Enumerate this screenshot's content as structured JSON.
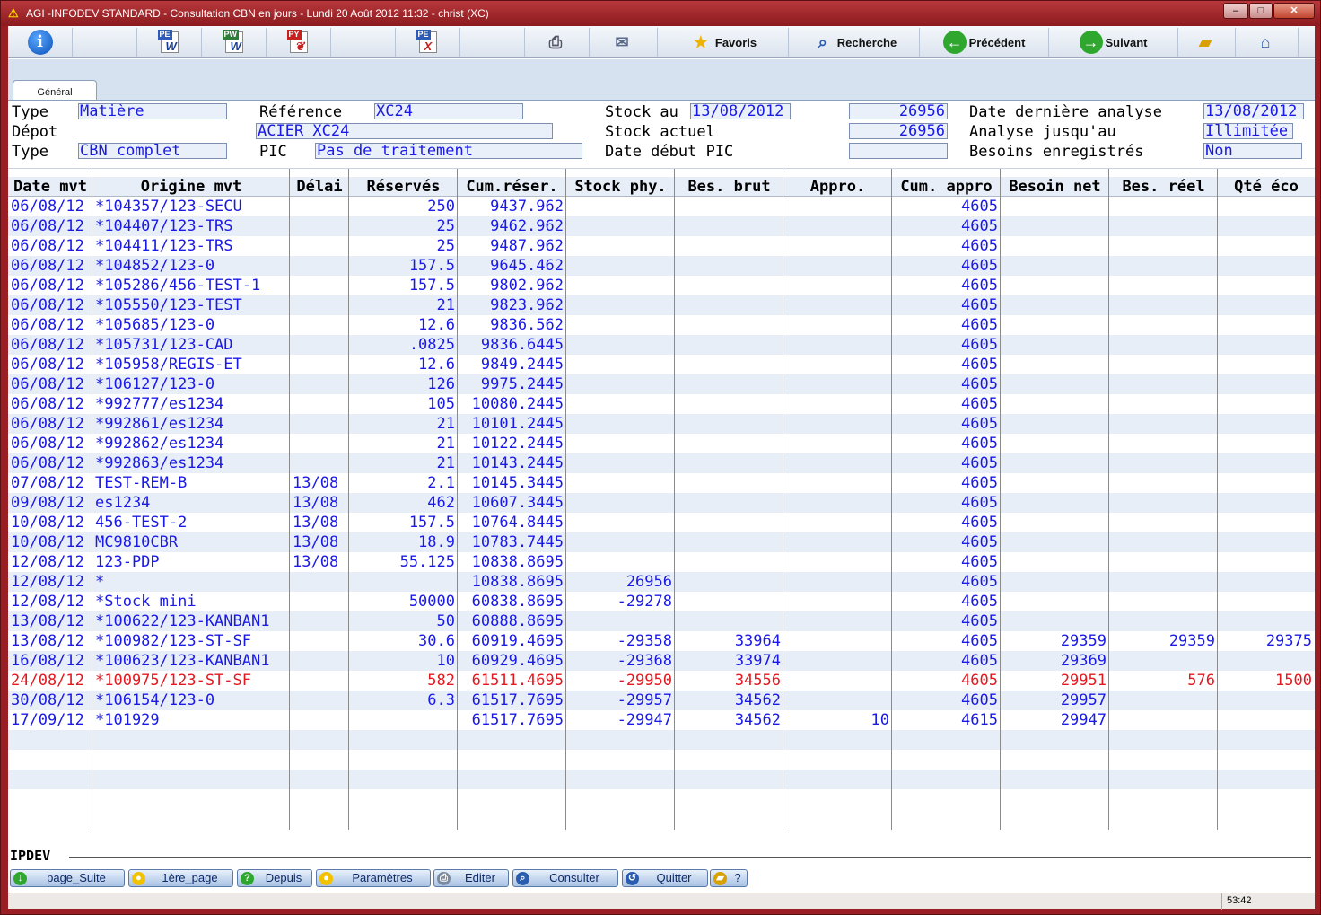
{
  "window": {
    "title": "AGI -INFODEV STANDARD - Consultation CBN en jours - Lundi 20 Août 2012 11:32 - christ (XC)"
  },
  "toolbar": {
    "favoris": "Favoris",
    "recherche": "Recherche",
    "precedent": "Précédent",
    "suivant": "Suivant",
    "doc_pe": "PE",
    "doc_pw": "PW",
    "doc_py": "PY",
    "doc_pe2": "PE"
  },
  "tab": {
    "label": "Général"
  },
  "header": {
    "type_label": "Type",
    "type_value": "Matière",
    "depot_label": "Dépot",
    "type2_label": "Type",
    "type2_value": "CBN complet",
    "reference_label": "Référence",
    "reference_value": "XC24",
    "designation_value": "ACIER XC24",
    "pic_label": "PIC",
    "pic_value": "Pas de traitement",
    "stock_au_label": "Stock au",
    "stock_au_date": "13/08/2012",
    "stock_au_value": "26956",
    "stock_actuel_label": "Stock actuel",
    "stock_actuel_value": "26956",
    "date_debut_pic_label": "Date début PIC",
    "date_debut_pic_value": "",
    "derniere_analyse_label": "Date dernière analyse",
    "derniere_analyse_value": "13/08/2012",
    "analyse_jusqu_label": "Analyse jusqu'au",
    "analyse_jusqu_value": "Illimitée",
    "besoins_label": "Besoins enregistrés",
    "besoins_value": "Non"
  },
  "table": {
    "columns": [
      "Date mvt",
      "Origine mvt",
      "Délai",
      "Réservés",
      "Cum.réser.",
      "Stock phy.",
      "Bes. brut",
      "Appro.",
      "Cum. appro",
      "Besoin net",
      "Bes. réel",
      "Qté éco"
    ],
    "rows": [
      {
        "d": "06/08/12",
        "o": "*104357/123-SECU",
        "del": "",
        "res": "250",
        "cumres": "9437.962",
        "phy": "",
        "brut": "",
        "appro": "",
        "cumappro": "4605",
        "net": "",
        "reel": "",
        "eco": "",
        "red": false
      },
      {
        "d": "06/08/12",
        "o": "*104407/123-TRS",
        "del": "",
        "res": "25",
        "cumres": "9462.962",
        "phy": "",
        "brut": "",
        "appro": "",
        "cumappro": "4605",
        "net": "",
        "reel": "",
        "eco": "",
        "red": false
      },
      {
        "d": "06/08/12",
        "o": "*104411/123-TRS",
        "del": "",
        "res": "25",
        "cumres": "9487.962",
        "phy": "",
        "brut": "",
        "appro": "",
        "cumappro": "4605",
        "net": "",
        "reel": "",
        "eco": "",
        "red": false
      },
      {
        "d": "06/08/12",
        "o": "*104852/123-0",
        "del": "",
        "res": "157.5",
        "cumres": "9645.462",
        "phy": "",
        "brut": "",
        "appro": "",
        "cumappro": "4605",
        "net": "",
        "reel": "",
        "eco": "",
        "red": false
      },
      {
        "d": "06/08/12",
        "o": "*105286/456-TEST-1",
        "del": "",
        "res": "157.5",
        "cumres": "9802.962",
        "phy": "",
        "brut": "",
        "appro": "",
        "cumappro": "4605",
        "net": "",
        "reel": "",
        "eco": "",
        "red": false
      },
      {
        "d": "06/08/12",
        "o": "*105550/123-TEST",
        "del": "",
        "res": "21",
        "cumres": "9823.962",
        "phy": "",
        "brut": "",
        "appro": "",
        "cumappro": "4605",
        "net": "",
        "reel": "",
        "eco": "",
        "red": false
      },
      {
        "d": "06/08/12",
        "o": "*105685/123-0",
        "del": "",
        "res": "12.6",
        "cumres": "9836.562",
        "phy": "",
        "brut": "",
        "appro": "",
        "cumappro": "4605",
        "net": "",
        "reel": "",
        "eco": "",
        "red": false
      },
      {
        "d": "06/08/12",
        "o": "*105731/123-CAD",
        "del": "",
        "res": ".0825",
        "cumres": "9836.6445",
        "phy": "",
        "brut": "",
        "appro": "",
        "cumappro": "4605",
        "net": "",
        "reel": "",
        "eco": "",
        "red": false
      },
      {
        "d": "06/08/12",
        "o": "*105958/REGIS-ET",
        "del": "",
        "res": "12.6",
        "cumres": "9849.2445",
        "phy": "",
        "brut": "",
        "appro": "",
        "cumappro": "4605",
        "net": "",
        "reel": "",
        "eco": "",
        "red": false
      },
      {
        "d": "06/08/12",
        "o": "*106127/123-0",
        "del": "",
        "res": "126",
        "cumres": "9975.2445",
        "phy": "",
        "brut": "",
        "appro": "",
        "cumappro": "4605",
        "net": "",
        "reel": "",
        "eco": "",
        "red": false
      },
      {
        "d": "06/08/12",
        "o": "*992777/es1234",
        "del": "",
        "res": "105",
        "cumres": "10080.2445",
        "phy": "",
        "brut": "",
        "appro": "",
        "cumappro": "4605",
        "net": "",
        "reel": "",
        "eco": "",
        "red": false
      },
      {
        "d": "06/08/12",
        "o": "*992861/es1234",
        "del": "",
        "res": "21",
        "cumres": "10101.2445",
        "phy": "",
        "brut": "",
        "appro": "",
        "cumappro": "4605",
        "net": "",
        "reel": "",
        "eco": "",
        "red": false
      },
      {
        "d": "06/08/12",
        "o": "*992862/es1234",
        "del": "",
        "res": "21",
        "cumres": "10122.2445",
        "phy": "",
        "brut": "",
        "appro": "",
        "cumappro": "4605",
        "net": "",
        "reel": "",
        "eco": "",
        "red": false
      },
      {
        "d": "06/08/12",
        "o": "*992863/es1234",
        "del": "",
        "res": "21",
        "cumres": "10143.2445",
        "phy": "",
        "brut": "",
        "appro": "",
        "cumappro": "4605",
        "net": "",
        "reel": "",
        "eco": "",
        "red": false
      },
      {
        "d": "07/08/12",
        "o": "TEST-REM-B",
        "del": "13/08",
        "res": "2.1",
        "cumres": "10145.3445",
        "phy": "",
        "brut": "",
        "appro": "",
        "cumappro": "4605",
        "net": "",
        "reel": "",
        "eco": "",
        "red": false
      },
      {
        "d": "09/08/12",
        "o": "es1234",
        "del": "13/08",
        "res": "462",
        "cumres": "10607.3445",
        "phy": "",
        "brut": "",
        "appro": "",
        "cumappro": "4605",
        "net": "",
        "reel": "",
        "eco": "",
        "red": false
      },
      {
        "d": "10/08/12",
        "o": "456-TEST-2",
        "del": "13/08",
        "res": "157.5",
        "cumres": "10764.8445",
        "phy": "",
        "brut": "",
        "appro": "",
        "cumappro": "4605",
        "net": "",
        "reel": "",
        "eco": "",
        "red": false
      },
      {
        "d": "10/08/12",
        "o": "MC9810CBR",
        "del": "13/08",
        "res": "18.9",
        "cumres": "10783.7445",
        "phy": "",
        "brut": "",
        "appro": "",
        "cumappro": "4605",
        "net": "",
        "reel": "",
        "eco": "",
        "red": false
      },
      {
        "d": "12/08/12",
        "o": "123-PDP",
        "del": "13/08",
        "res": "55.125",
        "cumres": "10838.8695",
        "phy": "",
        "brut": "",
        "appro": "",
        "cumappro": "4605",
        "net": "",
        "reel": "",
        "eco": "",
        "red": false
      },
      {
        "d": "12/08/12",
        "o": "*",
        "del": "",
        "res": "",
        "cumres": "10838.8695",
        "phy": "26956",
        "brut": "",
        "appro": "",
        "cumappro": "4605",
        "net": "",
        "reel": "",
        "eco": "",
        "red": false
      },
      {
        "d": "12/08/12",
        "o": "*Stock mini",
        "del": "",
        "res": "50000",
        "cumres": "60838.8695",
        "phy": "-29278",
        "brut": "",
        "appro": "",
        "cumappro": "4605",
        "net": "",
        "reel": "",
        "eco": "",
        "red": false
      },
      {
        "d": "13/08/12",
        "o": "*100622/123-KANBAN1",
        "del": "",
        "res": "50",
        "cumres": "60888.8695",
        "phy": "",
        "brut": "",
        "appro": "",
        "cumappro": "4605",
        "net": "",
        "reel": "",
        "eco": "",
        "red": false
      },
      {
        "d": "13/08/12",
        "o": "*100982/123-ST-SF",
        "del": "",
        "res": "30.6",
        "cumres": "60919.4695",
        "phy": "-29358",
        "brut": "33964",
        "appro": "",
        "cumappro": "4605",
        "net": "29359",
        "reel": "29359",
        "eco": "29375",
        "red": false
      },
      {
        "d": "16/08/12",
        "o": "*100623/123-KANBAN1",
        "del": "",
        "res": "10",
        "cumres": "60929.4695",
        "phy": "-29368",
        "brut": "33974",
        "appro": "",
        "cumappro": "4605",
        "net": "29369",
        "reel": "",
        "eco": "",
        "red": false
      },
      {
        "d": "24/08/12",
        "o": "*100975/123-ST-SF",
        "del": "",
        "res": "582",
        "cumres": "61511.4695",
        "phy": "-29950",
        "brut": "34556",
        "appro": "",
        "cumappro": "4605",
        "net": "29951",
        "reel": "576",
        "eco": "1500",
        "red": true
      },
      {
        "d": "30/08/12",
        "o": "*106154/123-0",
        "del": "",
        "res": "6.3",
        "cumres": "61517.7695",
        "phy": "-29957",
        "brut": "34562",
        "appro": "",
        "cumappro": "4605",
        "net": "29957",
        "reel": "",
        "eco": "",
        "red": false
      },
      {
        "d": "17/09/12",
        "o": "*101929",
        "del": "",
        "res": "",
        "cumres": "61517.7695",
        "phy": "-29947",
        "brut": "34562",
        "appro": "10",
        "cumappro": "4615",
        "net": "29947",
        "reel": "",
        "eco": "",
        "red": false
      }
    ]
  },
  "footer": {
    "program": "IPDEV",
    "buttons": [
      "page_Suite",
      "1ère_page",
      "Depuis",
      "Paramètres",
      "Editer",
      "Consulter",
      "Quitter",
      "?"
    ]
  },
  "status": {
    "clock": "53:42"
  },
  "colors": {
    "value_blue": "#1a1ae6",
    "alert_red": "#e3191f",
    "title_red": "#9a1f24"
  }
}
